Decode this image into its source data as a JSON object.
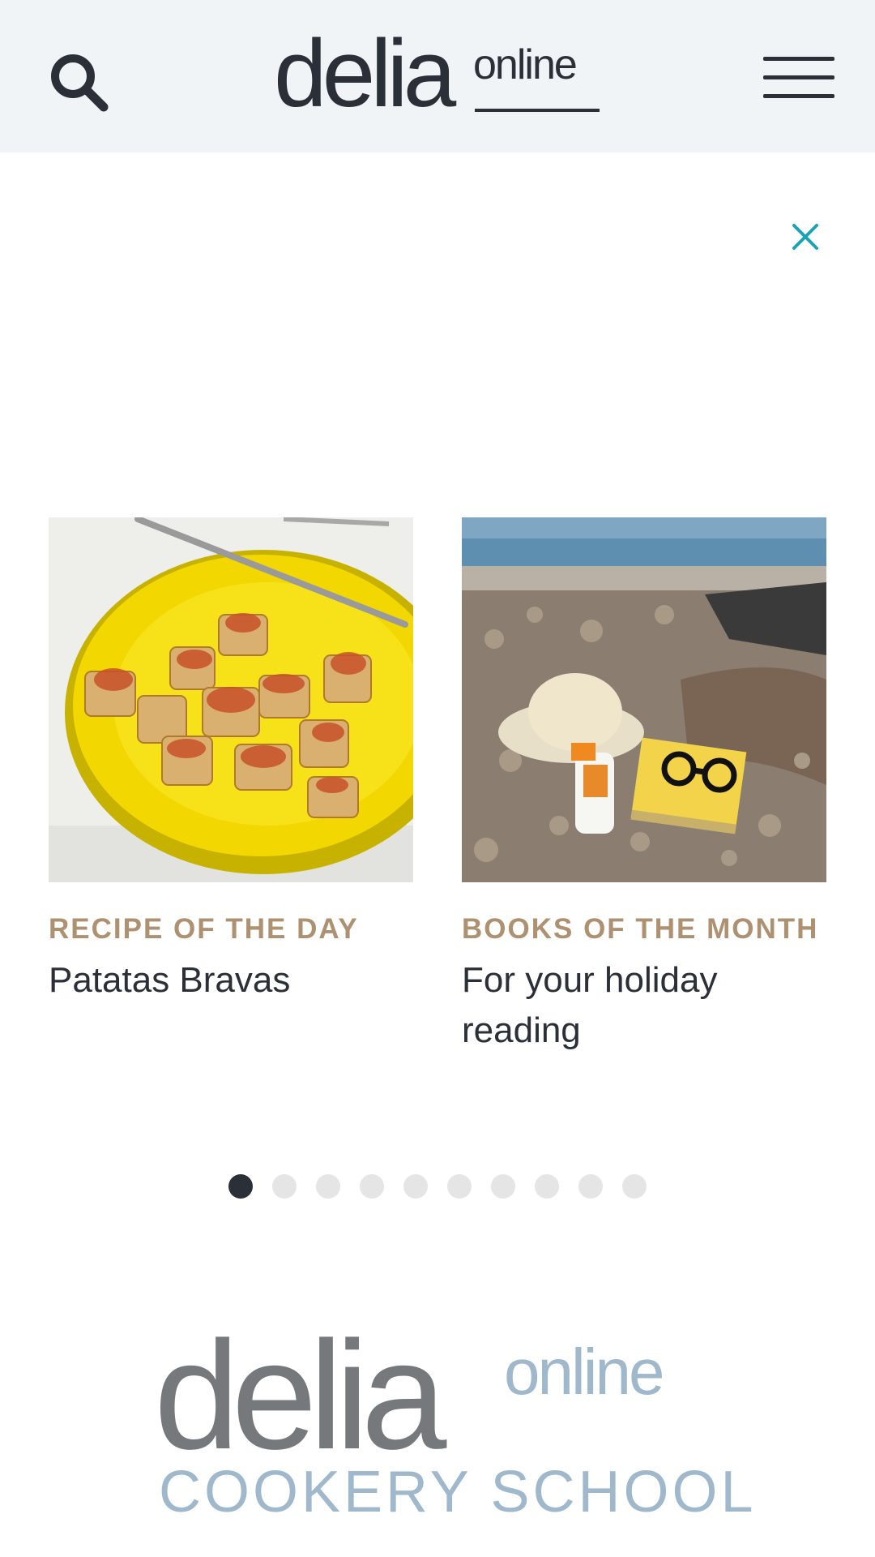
{
  "header": {
    "logo_main": "delia",
    "logo_sub": "online",
    "search_icon": "search-icon",
    "menu_icon": "hamburger-menu-icon"
  },
  "ad": {
    "close_icon": "close-icon",
    "close_color": "#1aa3b5"
  },
  "carousel": {
    "cards": [
      {
        "kicker": "RECIPE OF THE DAY",
        "title": "Patatas Bravas",
        "image": "patatas-bravas-photo"
      },
      {
        "kicker": "BOOKS OF THE MONTH",
        "title": "For your holiday reading",
        "image": "beach-hat-book-photo"
      }
    ],
    "page_count": 10,
    "active_index": 0
  },
  "cookery_school": {
    "logo_main": "delia",
    "logo_sub": "online",
    "logo_line": "COOKERY SCHOOL"
  },
  "colors": {
    "header_bg": "#f1f4f7",
    "text": "#2b3038",
    "kicker": "#ad9171",
    "cookery_blue": "#9fb8cc",
    "cookery_grey": "#76797c"
  }
}
